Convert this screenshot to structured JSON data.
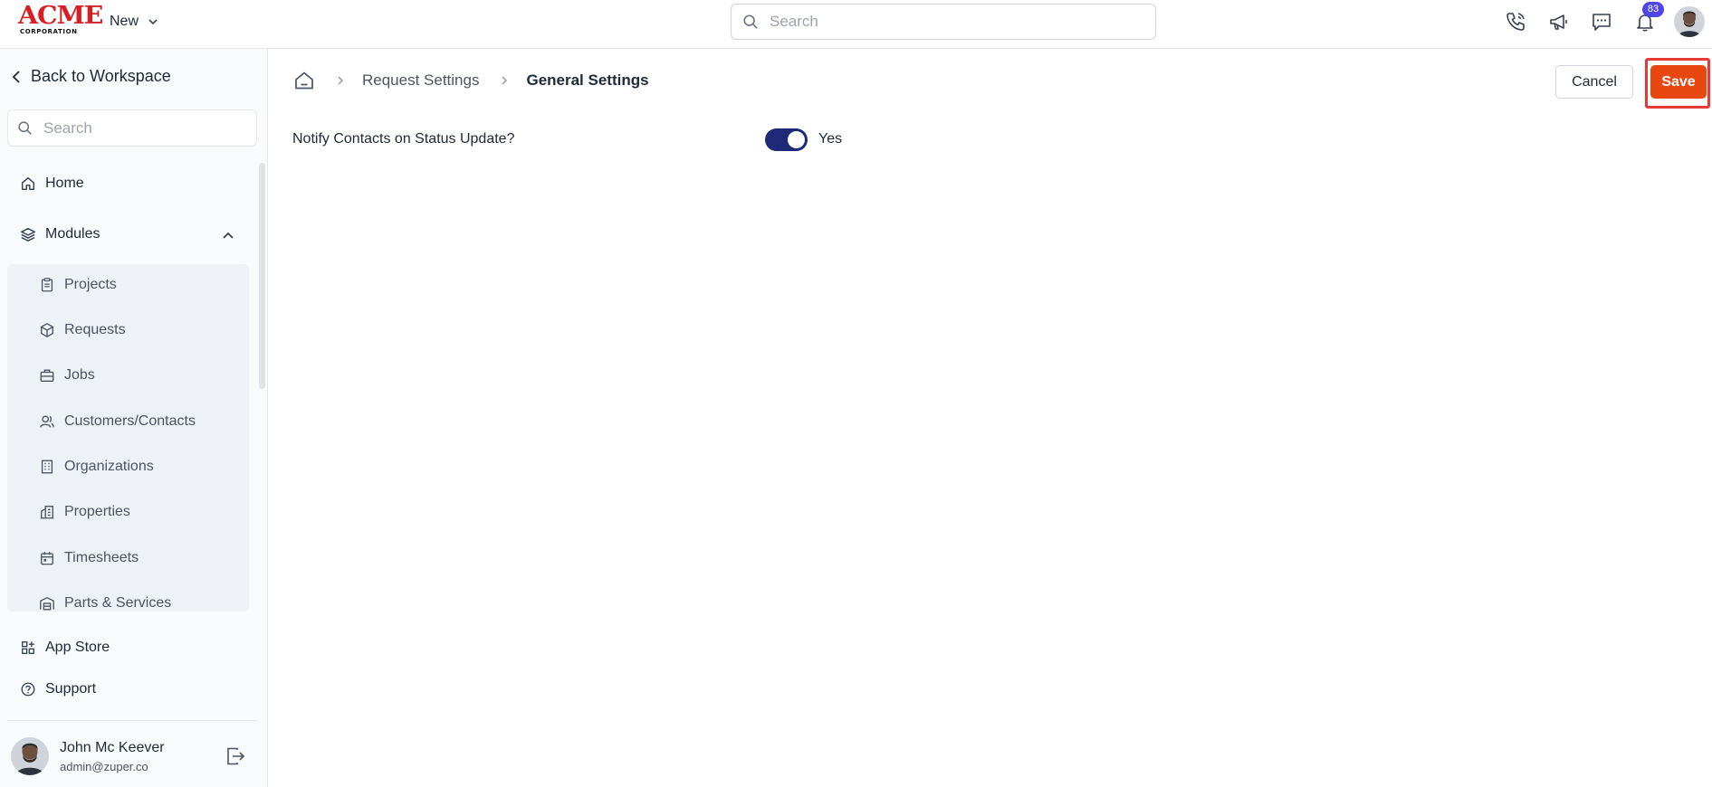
{
  "topbar": {
    "logo": {
      "brand": "ACME",
      "sub": "CORPORATION"
    },
    "new_label": "New",
    "search_placeholder": "Search",
    "notification_count": "83",
    "icons": [
      "phone-icon",
      "megaphone-icon",
      "chat-icon",
      "bell-icon"
    ]
  },
  "sidebar": {
    "back_label": "Back to Workspace",
    "search_placeholder": "Search",
    "home_label": "Home",
    "modules_label": "Modules",
    "modules": [
      {
        "label": "Projects",
        "icon": "clipboard-icon"
      },
      {
        "label": "Requests",
        "icon": "cube-icon"
      },
      {
        "label": "Jobs",
        "icon": "briefcase-icon"
      },
      {
        "label": "Customers/Contacts",
        "icon": "users-icon"
      },
      {
        "label": "Organizations",
        "icon": "building-icon"
      },
      {
        "label": "Properties",
        "icon": "property-icon"
      },
      {
        "label": "Timesheets",
        "icon": "calendar-icon"
      },
      {
        "label": "Parts & Services",
        "icon": "warehouse-icon"
      }
    ],
    "app_store_label": "App Store",
    "support_label": "Support",
    "user": {
      "name": "John Mc Keever",
      "email": "admin@zuper.co"
    }
  },
  "main": {
    "breadcrumb": {
      "parent": "Request Settings",
      "current": "General Settings"
    },
    "actions": {
      "cancel_label": "Cancel",
      "save_label": "Save"
    },
    "settings": [
      {
        "label": "Notify Contacts on Status Update?",
        "enabled": true,
        "value_label": "Yes"
      }
    ]
  },
  "colors": {
    "brand_red": "#d81e25",
    "save_orange": "#e8480f",
    "highlight_red": "#e53935",
    "toggle_navy": "#1e2a78",
    "badge_indigo": "#4f46e5"
  }
}
